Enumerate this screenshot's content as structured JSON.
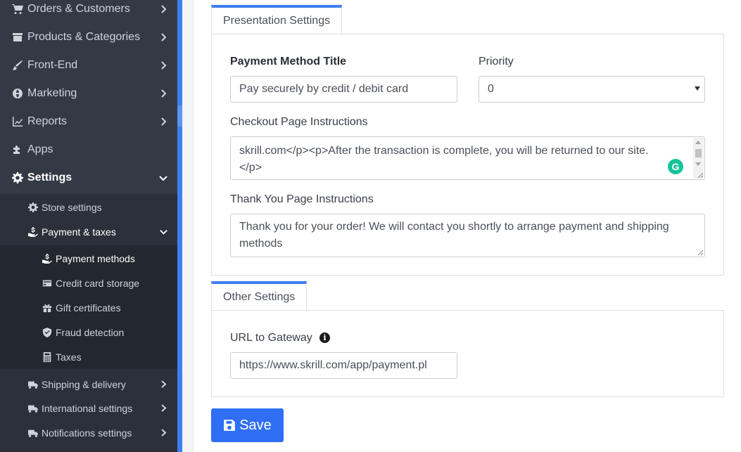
{
  "sidebar": {
    "items": [
      {
        "label": "Orders & Customers",
        "icon": "cart-icon"
      },
      {
        "label": "Products & Categories",
        "icon": "archive-icon"
      },
      {
        "label": "Front-End",
        "icon": "brush-icon"
      },
      {
        "label": "Marketing",
        "icon": "globe-icon"
      },
      {
        "label": "Reports",
        "icon": "chart-line-icon"
      },
      {
        "label": "Apps",
        "icon": "puzzle-icon"
      },
      {
        "label": "Settings",
        "icon": "gear-icon"
      }
    ],
    "settings_sub": [
      {
        "label": "Store settings",
        "icon": "gear-icon"
      },
      {
        "label": "Payment & taxes",
        "icon": "hand-coin-icon"
      }
    ],
    "payment_sub": [
      {
        "label": "Payment methods",
        "icon": "hand-coin-icon"
      },
      {
        "label": "Credit card storage",
        "icon": "credit-card-icon"
      },
      {
        "label": "Gift certificates",
        "icon": "gift-icon"
      },
      {
        "label": "Fraud detection",
        "icon": "shield-icon"
      },
      {
        "label": "Taxes",
        "icon": "calculator-icon"
      }
    ],
    "lower_sub": [
      {
        "label": "Shipping & delivery",
        "icon": "truck-icon"
      },
      {
        "label": "International settings",
        "icon": "truck-icon"
      },
      {
        "label": "Notifications settings",
        "icon": "truck-icon"
      }
    ]
  },
  "presentation": {
    "tab_label": "Presentation Settings",
    "title_label": "Payment Method Title",
    "title_value": "Pay securely by credit / debit card",
    "priority_label": "Priority",
    "priority_value": "0",
    "checkout_label": "Checkout Page Instructions",
    "checkout_value_line1": "skrill.com</p><p>After the transaction is complete, you will be returned to our site.",
    "checkout_value_line2": "</p>",
    "thankyou_label": "Thank You Page Instructions",
    "thankyou_value": "Thank you for your order! We will contact you shortly to arrange payment and shipping methods"
  },
  "other": {
    "tab_label": "Other Settings",
    "url_label": "URL to Gateway",
    "url_value": "https://www.skrill.com/app/payment.pl"
  },
  "save_label": "Save",
  "colors": {
    "accent": "#3d7ef0",
    "save_button": "#2f6ef5",
    "sidebar_bg": "#343a45",
    "grammarly": "#15c39a"
  }
}
